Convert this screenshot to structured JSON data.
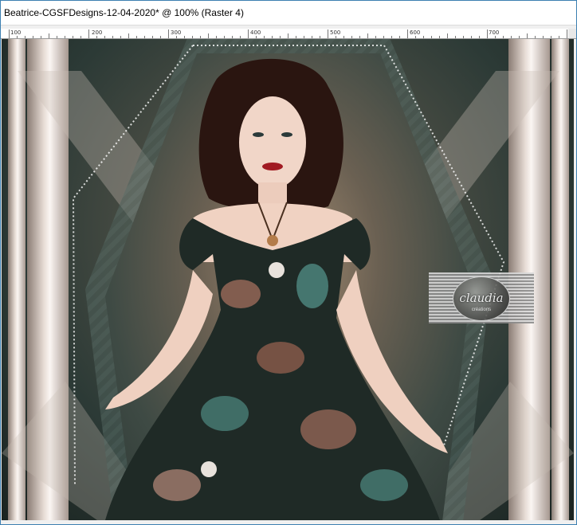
{
  "window": {
    "title": "Beatrice-CGSFDesigns-12-04-2020* @ 100% (Raster 4)"
  },
  "ruler": {
    "labels": [
      "100",
      "200",
      "300",
      "400",
      "500",
      "600",
      "700"
    ]
  },
  "canvas": {
    "watermark_text": "claudia",
    "watermark_subtext": "créations"
  },
  "colors": {
    "window_border": "#3c7fb1",
    "canvas_dark": "#1a2320",
    "accent_teal": "#4d5f59"
  }
}
